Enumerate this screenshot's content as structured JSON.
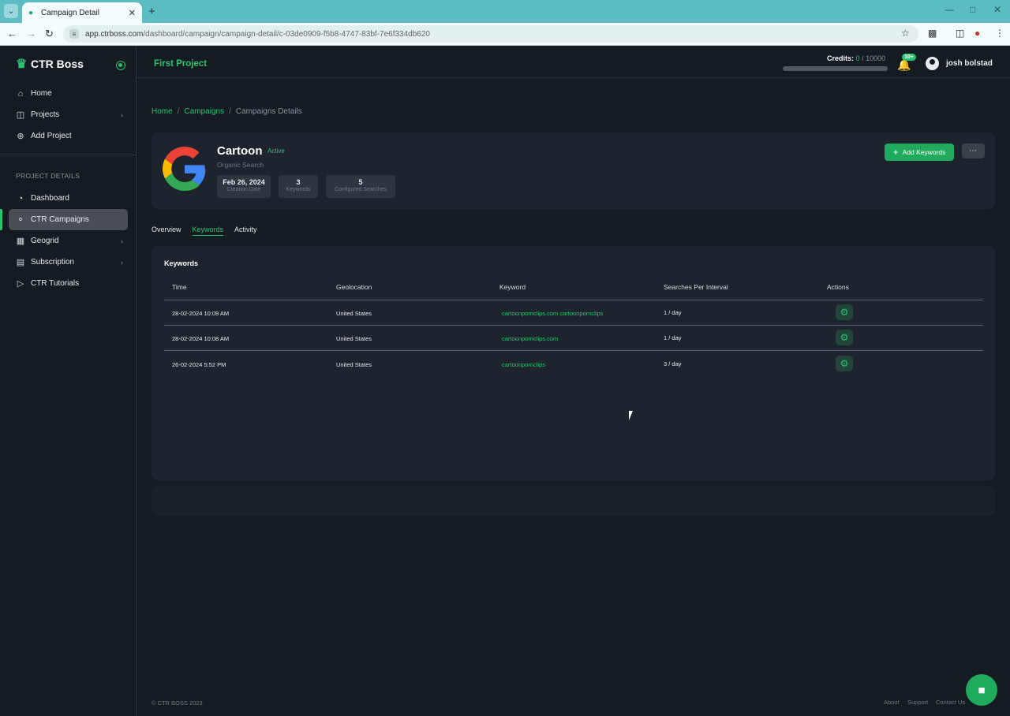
{
  "browser": {
    "tab_title": "Campaign Detail",
    "new_tab": "+",
    "url_host": "app.ctrboss.com",
    "url_path": "/dashboard/campaign/campaign-detail/c-03de0909-f5b8-4747-83bf-7e6f334db620"
  },
  "sidebar": {
    "brand": "CTR Boss",
    "items_top": [
      {
        "label": "Home",
        "icon": "home-icon"
      },
      {
        "label": "Projects",
        "icon": "cube-icon"
      },
      {
        "label": "Add Project",
        "icon": "plus-circle-icon"
      }
    ],
    "section_label": "PROJECT DETAILS",
    "items_project": [
      {
        "label": "Dashboard",
        "icon": "dashboard-icon"
      },
      {
        "label": "CTR Campaigns",
        "icon": "campaign-icon"
      },
      {
        "label": "Geogrid",
        "icon": "grid-icon"
      },
      {
        "label": "Subscription",
        "icon": "card-icon"
      },
      {
        "label": "CTR Tutorials",
        "icon": "video-icon"
      }
    ]
  },
  "topbar": {
    "project_title": "First Project",
    "credits_label": "Credits:",
    "credits_used": "0",
    "credits_total": "/ 10000",
    "credits_used_fraction": 0,
    "notification_badge": "10+",
    "username": "josh bolstad"
  },
  "breadcrumb": {
    "home": "Home",
    "campaigns": "Campaigns",
    "sep": "/",
    "current": "Campaigns Details"
  },
  "campaign": {
    "name": "Cartoon",
    "status": "Active",
    "subtitle": "Organic Search",
    "stats": [
      {
        "value": "Feb 26, 2024",
        "label": "Creation Date"
      },
      {
        "value": "3",
        "label": "Keywords"
      },
      {
        "value": "5",
        "label": "Configured Searches"
      }
    ],
    "add_keywords_label": "Add Keywords",
    "more_label": "⋯"
  },
  "tabs": [
    {
      "label": "Overview",
      "active": false
    },
    {
      "label": "Keywords",
      "active": true
    },
    {
      "label": "Activity",
      "active": false
    }
  ],
  "keywords": {
    "title": "Keywords",
    "columns": [
      "Time",
      "Geolocation",
      "Keyword",
      "Searches Per Interval",
      "Actions"
    ],
    "rows": [
      {
        "time": "28-02-2024 10:09 AM",
        "geo": "United States",
        "keyword": "cartoonpornclips.com cartoonpornclips",
        "interval": "1 / day"
      },
      {
        "time": "28-02-2024 10:08 AM",
        "geo": "United States",
        "keyword": "cartoonpornclips.com",
        "interval": "1 / day"
      },
      {
        "time": "26-02-2024 5:52 PM",
        "geo": "United States",
        "keyword": "cartoonpornclips",
        "interval": "3 / day"
      }
    ]
  },
  "footer": {
    "copyright": "© CTR BOSS 2023",
    "links": [
      "About",
      "Support",
      "Contact Us"
    ]
  },
  "colors": {
    "accent": "#29c46e",
    "background": "#151b23",
    "card": "#1d242d"
  }
}
